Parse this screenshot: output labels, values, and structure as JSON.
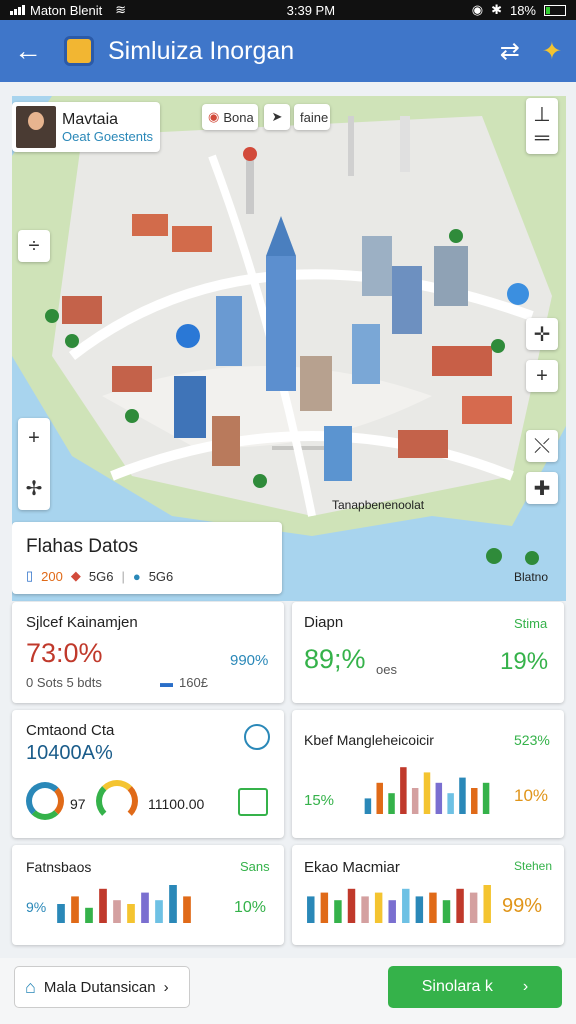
{
  "status": {
    "carrier": "Maton Blenit",
    "time": "3:39 PM",
    "battery": "18%"
  },
  "appbar": {
    "title": "Simluiza Inorgan"
  },
  "map": {
    "profile_name": "Mavtaia",
    "profile_sub": "Oeat Goestents",
    "chip1": "Bona",
    "chip2": "faine",
    "caption": "Tanapbenenoolat",
    "corner_label": "Blatno"
  },
  "overview": {
    "title": "Flahas Datos",
    "v1": "200",
    "v2": "5G6",
    "v3": "5G6"
  },
  "panel1": {
    "label": "Sjlcef Kainamjen",
    "value": "73:0%",
    "right": "990%",
    "foot_left": "0 Sots 5 bdts",
    "foot_right": "160£"
  },
  "panel2": {
    "label": "Diapn",
    "right_label": "Stima",
    "value": "89;%",
    "suffix": "oes",
    "right_value": "19%"
  },
  "panel3": {
    "label": "Cmtaond Cta",
    "value": "10400A%",
    "n1": "97",
    "n2": "11100.00"
  },
  "panel4": {
    "label": "Kbef Mangleheicoicir",
    "right_value": "523%",
    "left_pct": "15%",
    "right_pct": "10%"
  },
  "panel5": {
    "label": "Fatnsbaos",
    "right_label": "Sans",
    "left_pct": "9%",
    "right_pct": "10%"
  },
  "panel6": {
    "label": "Ekao Macmiar",
    "right_label": "Stehen",
    "right_pct": "99%"
  },
  "bottom": {
    "left_button": "Mala Dutansican",
    "right_button": "Sinolara k"
  },
  "colors": {
    "appbar": "#3f76c9",
    "green": "#35b24a",
    "orange": "#e06a18",
    "blue": "#2a88b8"
  },
  "chart_data": [
    {
      "type": "bar",
      "values": [
        3,
        6,
        4,
        9,
        5,
        8,
        6,
        4,
        7,
        5,
        6
      ]
    },
    {
      "type": "bar",
      "values": [
        5,
        7,
        4,
        9,
        6,
        5,
        8,
        6,
        10,
        7
      ]
    },
    {
      "type": "bar",
      "values": [
        7,
        8,
        6,
        9,
        7,
        8,
        6,
        9,
        7,
        8,
        6,
        9,
        8,
        10
      ]
    }
  ]
}
